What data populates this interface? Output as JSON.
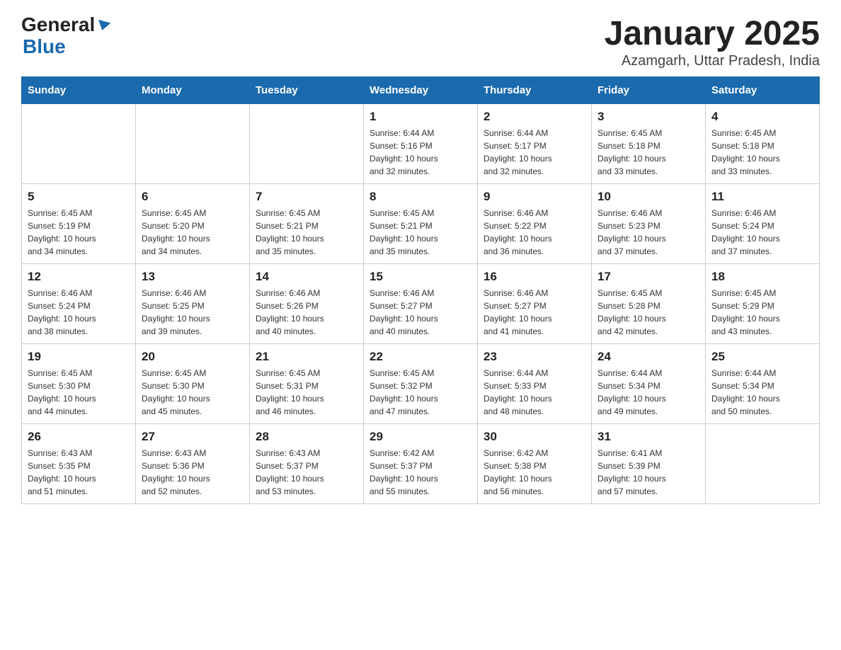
{
  "logo": {
    "line1": "General",
    "line2": "Blue"
  },
  "title": "January 2025",
  "subtitle": "Azamgarh, Uttar Pradesh, India",
  "weekdays": [
    "Sunday",
    "Monday",
    "Tuesday",
    "Wednesday",
    "Thursday",
    "Friday",
    "Saturday"
  ],
  "weeks": [
    [
      {
        "day": "",
        "info": ""
      },
      {
        "day": "",
        "info": ""
      },
      {
        "day": "",
        "info": ""
      },
      {
        "day": "1",
        "info": "Sunrise: 6:44 AM\nSunset: 5:16 PM\nDaylight: 10 hours\nand 32 minutes."
      },
      {
        "day": "2",
        "info": "Sunrise: 6:44 AM\nSunset: 5:17 PM\nDaylight: 10 hours\nand 32 minutes."
      },
      {
        "day": "3",
        "info": "Sunrise: 6:45 AM\nSunset: 5:18 PM\nDaylight: 10 hours\nand 33 minutes."
      },
      {
        "day": "4",
        "info": "Sunrise: 6:45 AM\nSunset: 5:18 PM\nDaylight: 10 hours\nand 33 minutes."
      }
    ],
    [
      {
        "day": "5",
        "info": "Sunrise: 6:45 AM\nSunset: 5:19 PM\nDaylight: 10 hours\nand 34 minutes."
      },
      {
        "day": "6",
        "info": "Sunrise: 6:45 AM\nSunset: 5:20 PM\nDaylight: 10 hours\nand 34 minutes."
      },
      {
        "day": "7",
        "info": "Sunrise: 6:45 AM\nSunset: 5:21 PM\nDaylight: 10 hours\nand 35 minutes."
      },
      {
        "day": "8",
        "info": "Sunrise: 6:45 AM\nSunset: 5:21 PM\nDaylight: 10 hours\nand 35 minutes."
      },
      {
        "day": "9",
        "info": "Sunrise: 6:46 AM\nSunset: 5:22 PM\nDaylight: 10 hours\nand 36 minutes."
      },
      {
        "day": "10",
        "info": "Sunrise: 6:46 AM\nSunset: 5:23 PM\nDaylight: 10 hours\nand 37 minutes."
      },
      {
        "day": "11",
        "info": "Sunrise: 6:46 AM\nSunset: 5:24 PM\nDaylight: 10 hours\nand 37 minutes."
      }
    ],
    [
      {
        "day": "12",
        "info": "Sunrise: 6:46 AM\nSunset: 5:24 PM\nDaylight: 10 hours\nand 38 minutes."
      },
      {
        "day": "13",
        "info": "Sunrise: 6:46 AM\nSunset: 5:25 PM\nDaylight: 10 hours\nand 39 minutes."
      },
      {
        "day": "14",
        "info": "Sunrise: 6:46 AM\nSunset: 5:26 PM\nDaylight: 10 hours\nand 40 minutes."
      },
      {
        "day": "15",
        "info": "Sunrise: 6:46 AM\nSunset: 5:27 PM\nDaylight: 10 hours\nand 40 minutes."
      },
      {
        "day": "16",
        "info": "Sunrise: 6:46 AM\nSunset: 5:27 PM\nDaylight: 10 hours\nand 41 minutes."
      },
      {
        "day": "17",
        "info": "Sunrise: 6:45 AM\nSunset: 5:28 PM\nDaylight: 10 hours\nand 42 minutes."
      },
      {
        "day": "18",
        "info": "Sunrise: 6:45 AM\nSunset: 5:29 PM\nDaylight: 10 hours\nand 43 minutes."
      }
    ],
    [
      {
        "day": "19",
        "info": "Sunrise: 6:45 AM\nSunset: 5:30 PM\nDaylight: 10 hours\nand 44 minutes."
      },
      {
        "day": "20",
        "info": "Sunrise: 6:45 AM\nSunset: 5:30 PM\nDaylight: 10 hours\nand 45 minutes."
      },
      {
        "day": "21",
        "info": "Sunrise: 6:45 AM\nSunset: 5:31 PM\nDaylight: 10 hours\nand 46 minutes."
      },
      {
        "day": "22",
        "info": "Sunrise: 6:45 AM\nSunset: 5:32 PM\nDaylight: 10 hours\nand 47 minutes."
      },
      {
        "day": "23",
        "info": "Sunrise: 6:44 AM\nSunset: 5:33 PM\nDaylight: 10 hours\nand 48 minutes."
      },
      {
        "day": "24",
        "info": "Sunrise: 6:44 AM\nSunset: 5:34 PM\nDaylight: 10 hours\nand 49 minutes."
      },
      {
        "day": "25",
        "info": "Sunrise: 6:44 AM\nSunset: 5:34 PM\nDaylight: 10 hours\nand 50 minutes."
      }
    ],
    [
      {
        "day": "26",
        "info": "Sunrise: 6:43 AM\nSunset: 5:35 PM\nDaylight: 10 hours\nand 51 minutes."
      },
      {
        "day": "27",
        "info": "Sunrise: 6:43 AM\nSunset: 5:36 PM\nDaylight: 10 hours\nand 52 minutes."
      },
      {
        "day": "28",
        "info": "Sunrise: 6:43 AM\nSunset: 5:37 PM\nDaylight: 10 hours\nand 53 minutes."
      },
      {
        "day": "29",
        "info": "Sunrise: 6:42 AM\nSunset: 5:37 PM\nDaylight: 10 hours\nand 55 minutes."
      },
      {
        "day": "30",
        "info": "Sunrise: 6:42 AM\nSunset: 5:38 PM\nDaylight: 10 hours\nand 56 minutes."
      },
      {
        "day": "31",
        "info": "Sunrise: 6:41 AM\nSunset: 5:39 PM\nDaylight: 10 hours\nand 57 minutes."
      },
      {
        "day": "",
        "info": ""
      }
    ]
  ]
}
